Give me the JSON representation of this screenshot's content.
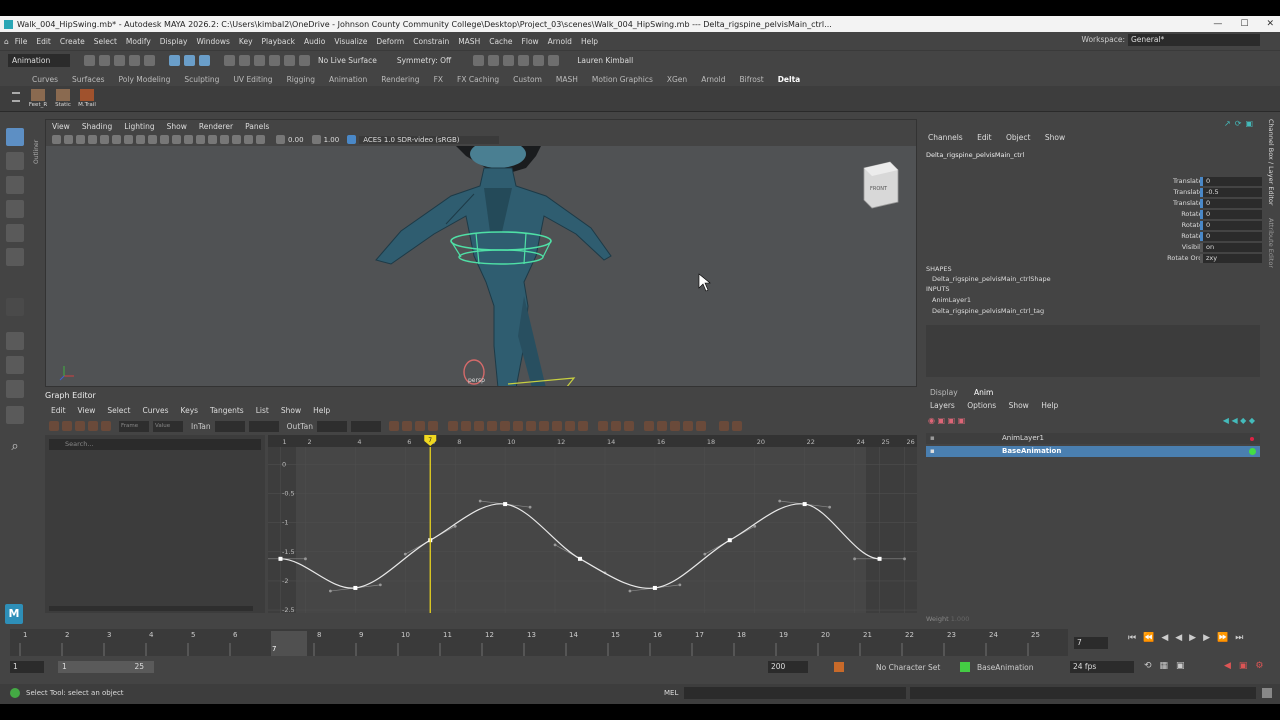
{
  "window": {
    "title": "Walk_004_HipSwing.mb* - Autodesk MAYA 2026.2: C:\\Users\\kimbal2\\OneDrive - Johnson County Community College\\Desktop\\Project_03\\scenes\\Walk_004_HipSwing.mb  ---   Delta_rigspine_pelvisMain_ctrl..."
  },
  "menu": [
    "File",
    "Edit",
    "Create",
    "Select",
    "Modify",
    "Display",
    "Windows",
    "Key",
    "Playback",
    "Audio",
    "Visualize",
    "Deform",
    "Constrain",
    "MASH",
    "Cache",
    "Flow",
    "Arnold",
    "Help"
  ],
  "workspace": {
    "label": "Workspace:",
    "value": "General*"
  },
  "status": {
    "mode": "Animation",
    "live_surface": "No Live Surface",
    "symmetry": "Symmetry: Off",
    "user": "Lauren Kimball"
  },
  "shelf_tabs": [
    "Curves",
    "Surfaces",
    "Poly Modeling",
    "Sculpting",
    "UV Editing",
    "Rigging",
    "Animation",
    "Rendering",
    "FX",
    "FX Caching",
    "Custom",
    "MASH",
    "Motion Graphics",
    "XGen",
    "Arnold",
    "Bifrost",
    "Delta"
  ],
  "shelf_items": [
    "Feet_R",
    "Static",
    "M.Trail"
  ],
  "outliner_tab": "Outliner",
  "viewport": {
    "menu": [
      "View",
      "Shading",
      "Lighting",
      "Show",
      "Renderer",
      "Panels"
    ],
    "val1": "0.00",
    "val2": "1.00",
    "color_space": "ACES 1.0 SDR-video (sRGB)",
    "cam_label": "persp",
    "cube_label": "FRONT"
  },
  "graph_editor": {
    "title": "Graph Editor",
    "menu": [
      "Edit",
      "View",
      "Select",
      "Curves",
      "Keys",
      "Tangents",
      "List",
      "Show",
      "Help"
    ],
    "stats": {
      "frame": "Frame",
      "value": "Value"
    },
    "intan": "InTan",
    "outtan": "OutTan",
    "search_placeholder": "Search...",
    "frame_ticks": [
      "1",
      "2",
      "4",
      "6",
      "7",
      "8",
      "10",
      "12",
      "14",
      "16",
      "18",
      "20",
      "22",
      "24",
      "25",
      "26"
    ],
    "value_ticks": [
      "0",
      "-0.5",
      "-1",
      "-1.5",
      "-2",
      "-2.5"
    ]
  },
  "chart_data": {
    "type": "line",
    "xlabel": "",
    "ylabel": "",
    "x_range": [
      0.5,
      26.5
    ],
    "y_range": [
      -2.55,
      0.3
    ],
    "current_frame": 7,
    "series": [
      {
        "name": "",
        "keys": [
          [
            1,
            -1.62
          ],
          [
            4,
            -2.12
          ],
          [
            7,
            -1.3
          ],
          [
            10,
            -0.68
          ],
          [
            13,
            -1.62
          ],
          [
            16,
            -2.12
          ],
          [
            19,
            -1.3
          ],
          [
            22,
            -0.68
          ],
          [
            25,
            -1.62
          ]
        ]
      }
    ]
  },
  "channel_box": {
    "menu": [
      "Channels",
      "Edit",
      "Object",
      "Show"
    ],
    "object": "Delta_rigspine_pelvisMain_ctrl",
    "attrs": [
      {
        "label": "Translate X",
        "value": "0"
      },
      {
        "label": "Translate Y",
        "value": "-0.5"
      },
      {
        "label": "Translate Z",
        "value": "0"
      },
      {
        "label": "Rotate X",
        "value": "0"
      },
      {
        "label": "Rotate Y",
        "value": "0"
      },
      {
        "label": "Rotate Z",
        "value": "0"
      },
      {
        "label": "Visibility",
        "value": "on"
      },
      {
        "label": "Rotate Order",
        "value": "zxy"
      }
    ],
    "shapes_header": "SHAPES",
    "shape": "Delta_rigspine_pelvisMain_ctrlShape",
    "inputs_header": "INPUTS",
    "inputs": [
      "AnimLayer1",
      "Delta_rigspine_pelvisMain_ctrl_tag"
    ]
  },
  "layer_editor": {
    "tabs": [
      "Display",
      "Anim"
    ],
    "menu": [
      "Layers",
      "Options",
      "Show",
      "Help"
    ],
    "layers": [
      "AnimLayer1",
      "BaseAnimation"
    ],
    "weight_label": "Weight",
    "weight_value": "1.000"
  },
  "side_tabs": [
    "Channel Box / Layer Editor",
    "Attribute Editor"
  ],
  "time_slider": {
    "ticks": [
      "1",
      "2",
      "3",
      "4",
      "5",
      "6",
      "7",
      "8",
      "9",
      "10",
      "11",
      "12",
      "13",
      "14",
      "15",
      "16",
      "17",
      "18",
      "19",
      "20",
      "21",
      "22",
      "23",
      "24",
      "25"
    ],
    "current": "7",
    "current_field": "7"
  },
  "range": {
    "start": "1",
    "inner_start": "1",
    "inner_end": "25",
    "end": "200",
    "char_set": "No Character Set",
    "anim_layer": "BaseAnimation",
    "fps": "24 fps"
  },
  "cmd": {
    "help": "Select Tool: select an object",
    "lang": "MEL"
  }
}
